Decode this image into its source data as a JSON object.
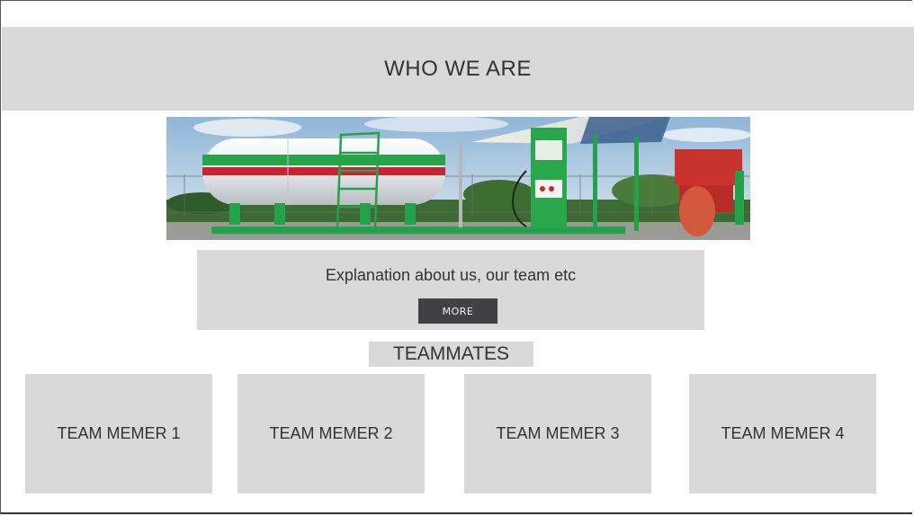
{
  "hero": {
    "title": "WHO WE ARE"
  },
  "banner": {
    "subject": "lpg-storage-tank-and-fuel-dispenser"
  },
  "about": {
    "text": "Explanation about us, our team etc",
    "more_label": "MORE"
  },
  "team": {
    "heading": "TEAMMATES",
    "members": [
      {
        "label": "TEAM MEMER 1"
      },
      {
        "label": "TEAM MEMER 2"
      },
      {
        "label": "TEAM MEMER 3"
      },
      {
        "label": "TEAM MEMER 4"
      }
    ]
  },
  "colors": {
    "panel_gray": "#d9d9d9",
    "button_dark": "#3f4142",
    "text": "#333333"
  }
}
